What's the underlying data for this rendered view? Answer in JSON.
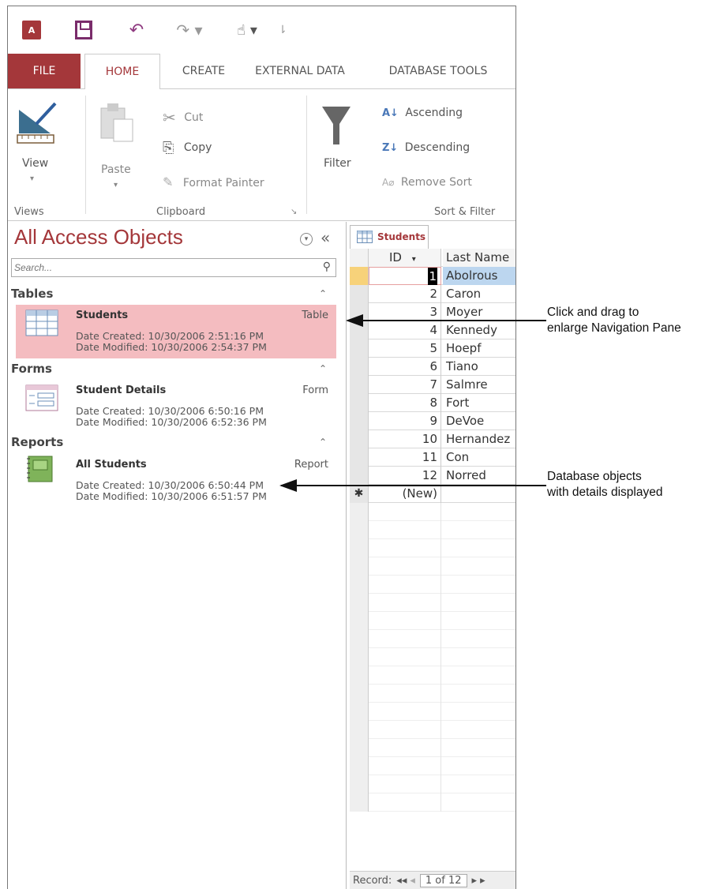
{
  "qat": {
    "app_icon": "A",
    "undo": "↶",
    "redo": "↷ ▾",
    "touch": "☝ ▾",
    "customize": "⇂"
  },
  "tabs": [
    "FILE",
    "HOME",
    "CREATE",
    "EXTERNAL DATA",
    "DATABASE TOOLS"
  ],
  "ribbon": {
    "view": "View",
    "view_drop": "▾",
    "paste": "Paste",
    "paste_drop": "▾",
    "cut": "Cut",
    "copy": "Copy",
    "format_painter": "Format Painter",
    "filter": "Filter",
    "ascending": "Ascending",
    "descending": "Descending",
    "remove_sort": "Remove Sort",
    "groups": {
      "views": "Views",
      "clipboard": "Clipboard",
      "sort_filter": "Sort & Filter"
    }
  },
  "nav": {
    "title": "All Access Objects",
    "search_placeholder": "Search...",
    "groups": [
      {
        "name": "Tables",
        "items": [
          {
            "name": "Students",
            "type": "Table",
            "created": "Date Created: 10/30/2006 2:51:16 PM",
            "modified": "Date Modified: 10/30/2006 2:54:37 PM"
          }
        ]
      },
      {
        "name": "Forms",
        "items": [
          {
            "name": "Student Details",
            "type": "Form",
            "created": "Date Created: 10/30/2006 6:50:16 PM",
            "modified": "Date Modified: 10/30/2006 6:52:36 PM"
          }
        ]
      },
      {
        "name": "Reports",
        "items": [
          {
            "name": "All Students",
            "type": "Report",
            "created": "Date Created: 10/30/2006 6:50:44 PM",
            "modified": "Date Modified: 10/30/2006 6:51:57 PM"
          }
        ]
      }
    ]
  },
  "datasheet": {
    "tab": "Students",
    "columns": [
      "ID",
      "Last Name"
    ],
    "rows": [
      [
        "1",
        "Abolrous"
      ],
      [
        "2",
        "Caron"
      ],
      [
        "3",
        "Moyer"
      ],
      [
        "4",
        "Kennedy"
      ],
      [
        "5",
        "Hoepf"
      ],
      [
        "6",
        "Tiano"
      ],
      [
        "7",
        "Salmre"
      ],
      [
        "8",
        "Fort"
      ],
      [
        "9",
        "DeVoe"
      ],
      [
        "10",
        "Hernandez"
      ],
      [
        "11",
        "Con"
      ],
      [
        "12",
        "Norred"
      ]
    ],
    "new_row": "(New)",
    "new_marker": "✱",
    "record_label": "Record:",
    "record_first": "◂◂",
    "record_prev": "◂",
    "record_next": "▸ ▸",
    "record_pos": "1 of 12"
  },
  "annotations": {
    "drag": [
      "Click and drag to",
      "enlarge Navigation Pane"
    ],
    "objects": [
      "Database objects",
      "with details displayed"
    ]
  },
  "colors": {
    "accent": "#a4373a",
    "selected_bg": "#f4bcc0"
  }
}
